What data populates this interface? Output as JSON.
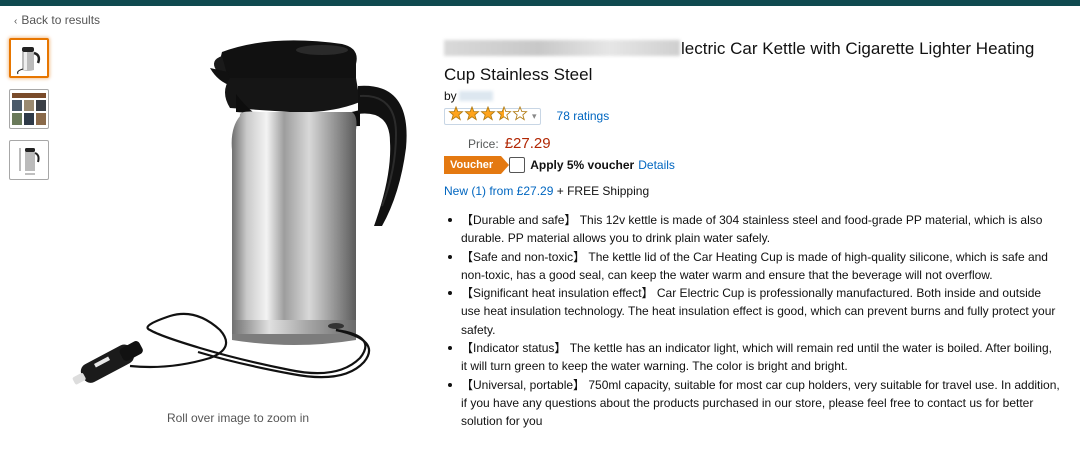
{
  "nav": {
    "back_label": "Back to results",
    "back_icon": "chevron-left-icon"
  },
  "thumbnails": [
    {
      "name": "thumbnail-kettle-front",
      "active": true
    },
    {
      "name": "thumbnail-product-collage",
      "active": false
    },
    {
      "name": "thumbnail-kettle-dimensions",
      "active": false
    }
  ],
  "image": {
    "zoom_hint": "Roll over image to zoom in"
  },
  "product": {
    "title": "Qilia 12V 750mL Car Kettle, Electric Car Kettle with Cigarette Lighter Heating Cup Stainless Steel",
    "title_visible_tail": "lectric Car Kettle with Cigarette Lighter Heating Cup Stainless Steel",
    "by_label": "by",
    "rating_stars": 3.5,
    "rating_count": "78 ratings",
    "price_label": "Price:",
    "price": "£27.29",
    "voucher_badge": "Voucher",
    "voucher_text": "Apply 5% voucher",
    "details_link": "Details",
    "new_from_link": "New (1) from £27.29",
    "shipping": "+ FREE Shipping"
  },
  "bullets": [
    "【Durable and safe】 This 12v kettle is made of 304 stainless steel and food-grade PP material, which is also durable. PP material allows you to drink plain water safely.",
    "【Safe and non-toxic】 The kettle lid of the Car Heating Cup is made of high-quality silicone, which is safe and non-toxic, has a good seal, can keep the water warm and ensure that the beverage will not overflow.",
    "【Significant heat insulation effect】 Car Electric Cup is professionally manufactured. Both inside and outside use heat insulation technology. The heat insulation effect is good, which can prevent burns and fully protect your safety.",
    "【Indicator status】 The kettle has an indicator light, which will remain red until the water is boiled. After boiling, it will turn green to keep the water warning. The color is bright and bright.",
    "【Universal, portable】 750ml capacity, suitable for most car cup holders, very suitable for travel use. In addition, if you have any questions about the products purchased in our store, please feel free to contact us for better solution for you"
  ],
  "colors": {
    "link": "#0066c0",
    "price": "#b12704",
    "voucher": "#e47911",
    "star": "#ffa41c",
    "top_strip": "#0f4a4f"
  }
}
